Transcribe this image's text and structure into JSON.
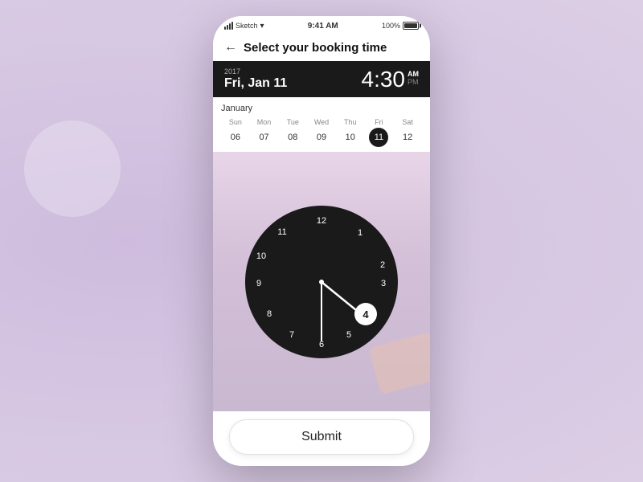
{
  "statusBar": {
    "carrier": "Sketch",
    "time": "9:41 AM",
    "battery": "100%"
  },
  "header": {
    "backLabel": "←",
    "title": "Select your booking time"
  },
  "datetime": {
    "year": "2017",
    "dateLabel": "Fri, Jan 11",
    "timeDisplay": "4:30",
    "amLabel": "AM",
    "pmLabel": "PM"
  },
  "calendar": {
    "monthLabel": "January",
    "dayHeaders": [
      "Sun",
      "Mon",
      "Tue",
      "Wed",
      "Thu",
      "Fri",
      "Sat"
    ],
    "days": [
      {
        "num": "06",
        "selected": false
      },
      {
        "num": "07",
        "selected": false
      },
      {
        "num": "08",
        "selected": false
      },
      {
        "num": "09",
        "selected": false
      },
      {
        "num": "10",
        "selected": false
      },
      {
        "num": "11",
        "selected": true
      },
      {
        "num": "12",
        "selected": false
      }
    ]
  },
  "clock": {
    "numbers": [
      {
        "label": "12",
        "angle": 0,
        "r": 78
      },
      {
        "label": "1",
        "angle": 30,
        "r": 78
      },
      {
        "label": "2",
        "angle": 60,
        "r": 78
      },
      {
        "label": "3",
        "angle": 90,
        "r": 78
      },
      {
        "label": "4",
        "angle": 120,
        "r": 78
      },
      {
        "label": "5",
        "angle": 150,
        "r": 78
      },
      {
        "label": "6",
        "angle": 180,
        "r": 78
      },
      {
        "label": "7",
        "angle": 210,
        "r": 78
      },
      {
        "label": "8",
        "angle": 240,
        "r": 78
      },
      {
        "label": "9",
        "angle": 270,
        "r": 78
      },
      {
        "label": "10",
        "angle": 300,
        "r": 78
      },
      {
        "label": "11",
        "angle": 330,
        "r": 78
      }
    ],
    "selectedHour": "4"
  },
  "submitBtn": {
    "label": "Submit"
  }
}
